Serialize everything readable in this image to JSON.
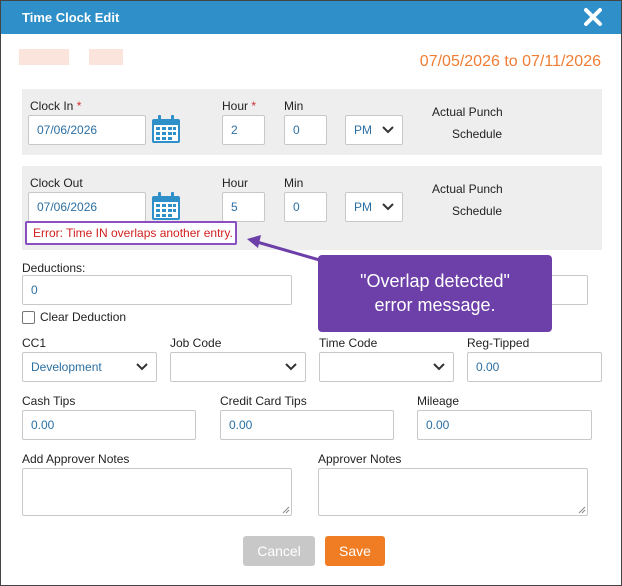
{
  "dialog": {
    "title": "Time Clock Edit",
    "date_range": "07/05/2026 to 07/11/2026"
  },
  "clock_in": {
    "label": "Clock In",
    "required_mark": "*",
    "date": "07/06/2026",
    "hour_label": "Hour",
    "hour_required_mark": "*",
    "hour": "2",
    "min_label": "Min",
    "min": "0",
    "ampm": "PM",
    "actual_punch": "Actual Punch",
    "schedule": "Schedule"
  },
  "clock_out": {
    "label": "Clock Out",
    "date": "07/06/2026",
    "hour_label": "Hour",
    "hour": "5",
    "min_label": "Min",
    "min": "0",
    "ampm": "PM",
    "actual_punch": "Actual Punch",
    "schedule": "Schedule"
  },
  "error": {
    "message": "Error: Time IN overlaps another entry."
  },
  "callout": {
    "line1": "\"Overlap detected\"",
    "line2": "error message."
  },
  "deductions": {
    "label": "Deductions:",
    "value": "0",
    "clear_label": "Clear Deduction"
  },
  "fields": {
    "cc1_label": "CC1",
    "cc1_value": "Development",
    "job_code_label": "Job Code",
    "job_code_value": "",
    "time_code_label": "Time Code",
    "time_code_value": "",
    "reg_tipped_label": "Reg-Tipped",
    "reg_tipped_value": "0.00",
    "cash_tips_label": "Cash Tips",
    "cash_tips_value": "0.00",
    "cc_tips_label": "Credit Card Tips",
    "cc_tips_value": "0.00",
    "mileage_label": "Mileage",
    "mileage_value": "0.00",
    "add_notes_label": "Add Approver Notes",
    "notes_label": "Approver Notes"
  },
  "buttons": {
    "cancel": "Cancel",
    "save": "Save"
  },
  "colors": {
    "titlebar": "#2e8fc9",
    "accent_orange": "#f07d23",
    "error_red": "#d32020",
    "callout_purple": "#6d3fa8"
  }
}
